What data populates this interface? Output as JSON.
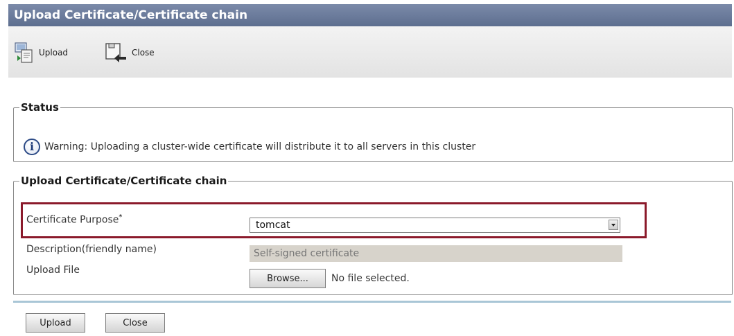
{
  "title": "Upload Certificate/Certificate chain",
  "toolbar": {
    "upload_label": "Upload",
    "close_label": "Close",
    "upload_icon": "upload-icon",
    "close_icon": "close-icon"
  },
  "status": {
    "legend": "Status",
    "icon": "info-icon",
    "icon_glyph": "i",
    "message": "Warning: Uploading a cluster-wide certificate will distribute it to all servers in this cluster"
  },
  "upload_form": {
    "legend": "Upload Certificate/Certificate chain",
    "purpose_label": "Certificate Purpose",
    "required_marker": "*",
    "purpose_value": "tomcat",
    "description_label": "Description(friendly name)",
    "description_placeholder": "Self-signed certificate",
    "file_label": "Upload File",
    "browse_label": "Browse...",
    "file_status": "No file selected."
  },
  "buttons": {
    "upload": "Upload",
    "close": "Close"
  },
  "colors": {
    "title_bar": "#6a7a9b",
    "highlight_border": "#8b1a2b",
    "divider": "#a9c6d6"
  }
}
